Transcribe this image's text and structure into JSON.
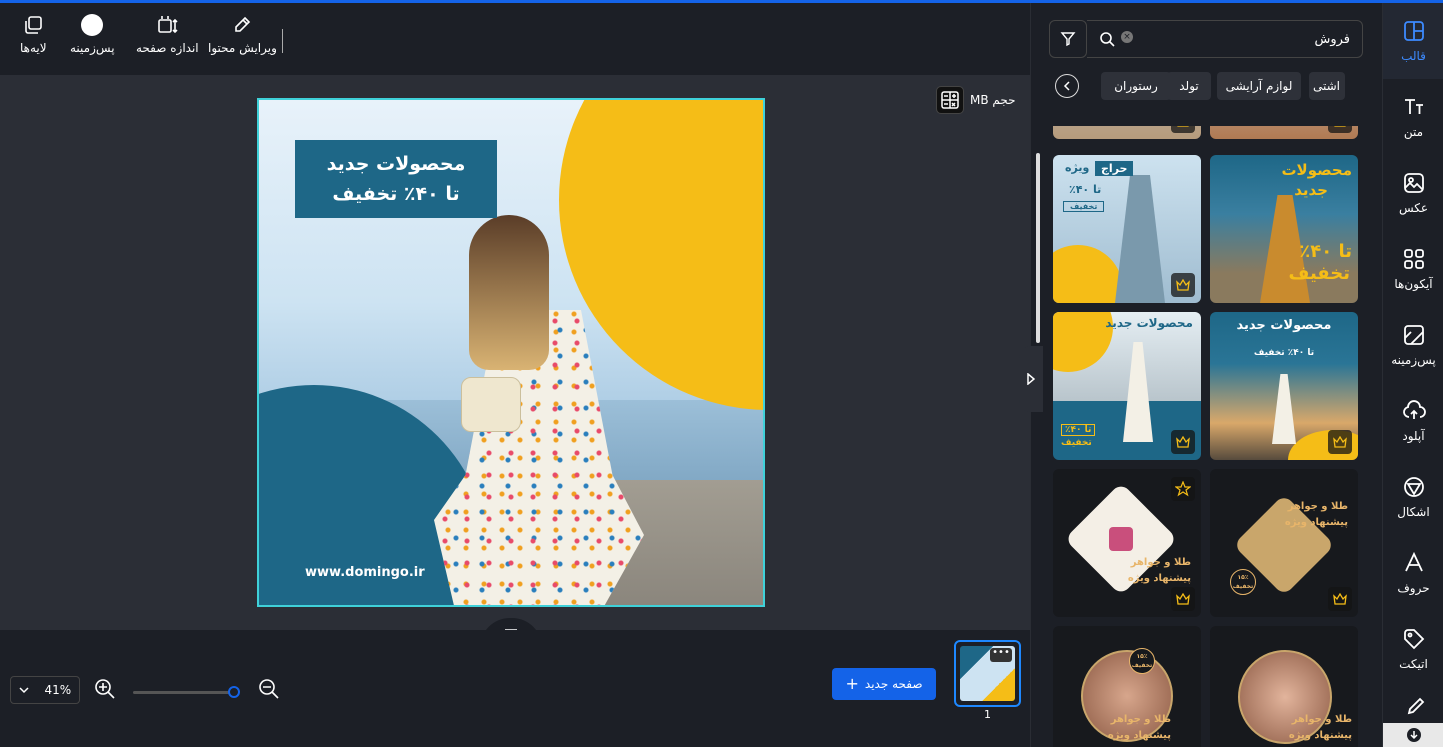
{
  "toolbar": {
    "layers": "لایه‌ها",
    "background": "پس‌زمینه",
    "page_size": "اندازه صفحه",
    "edit_content": "ویرایش محتوا"
  },
  "canvas": {
    "size_label": "حجم MB",
    "art_title_line1": "محصولات جدید",
    "art_title_line2": "تا ۴۰٪ تخفیف",
    "art_url": "www.domingo.ir"
  },
  "bottom": {
    "zoom": "41%",
    "new_page": "صفحه جدید",
    "page_number": "1"
  },
  "panel": {
    "search_value": "فروش",
    "categories": [
      "رستوران",
      "تولد",
      "لوازم آرایشی",
      "اشتی"
    ],
    "templates": [
      {
        "l1": "حراج",
        "l2": "ویژه",
        "l3": "تا ۴۰٪",
        "l4": "تخفیف"
      },
      {
        "l1": "محصولات",
        "l2": "جدید",
        "l3": "تا ۴۰٪",
        "l4": "تخفیف"
      },
      {
        "l1": "محصولات جدید",
        "l3": "تا ۴۰٪",
        "l4": "تخفیف"
      },
      {
        "l1": "محصولات جدید",
        "l3": "تا ۴۰٪ تخفیف"
      },
      {
        "l1": "طلا و جواهر",
        "l2": "پیشنهاد ویژه",
        "badge": "۱۵٪ تخفیف"
      },
      {
        "l1": "طلا و جواهر",
        "l2": "پیشنهاد ویژه",
        "badge": "۱۵٪ تخفیف"
      },
      {
        "l1": "طلا و جواهر",
        "l2": "پیشنهاد ویژه",
        "badge": "۱۵٪ تخفیف"
      },
      {
        "l1": "طلا و جواهر",
        "l2": "پیشنهاد ویژه"
      }
    ]
  },
  "nav": {
    "template": "قالب",
    "text": "متن",
    "photo": "عکس",
    "icons": "آیکون‌ها",
    "background": "پس‌زمینه",
    "upload": "آپلود",
    "shapes": "اشکال",
    "letters": "حروف",
    "label": "اتیکت"
  }
}
